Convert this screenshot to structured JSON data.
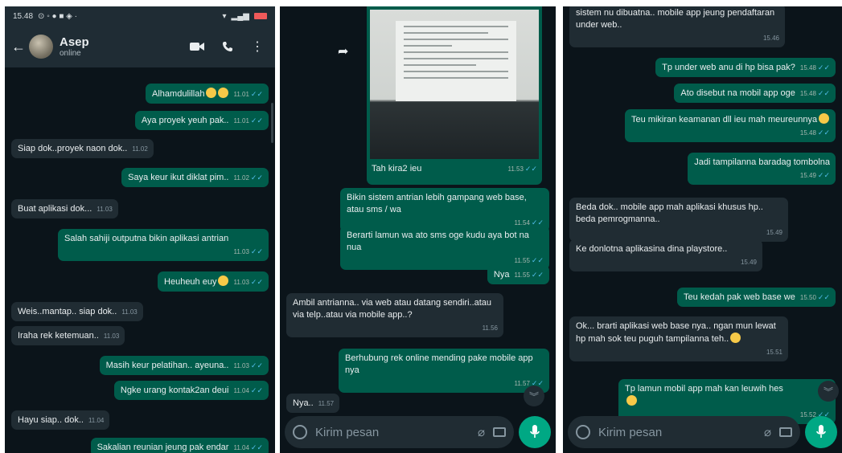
{
  "panel1": {
    "status_time": "15.48",
    "contact_name": "Asep",
    "contact_status": "online",
    "messages": [
      {
        "text": "Alhamdulillah",
        "time": "11.01",
        "dir": "out",
        "emoji": 2
      },
      {
        "text": "Aya proyek yeuh pak..",
        "time": "11.01",
        "dir": "out"
      },
      {
        "text": "Siap dok..proyek naon dok..",
        "time": "11.02",
        "dir": "in"
      },
      {
        "text": "Saya keur ikut diklat pim..",
        "time": "11.02",
        "dir": "out"
      },
      {
        "text": "Buat aplikasi dok...",
        "time": "11.03",
        "dir": "in"
      },
      {
        "text": "Salah sahiji outputna bikin aplikasi antrian",
        "time": "11.03",
        "dir": "out"
      },
      {
        "text": "Heuheuh euy",
        "time": "11.03",
        "dir": "out",
        "emoji": 1
      },
      {
        "text": "Weis..mantap.. siap dok..",
        "time": "11.03",
        "dir": "in"
      },
      {
        "text": "Iraha rek ketemuan..",
        "time": "11.03",
        "dir": "in"
      },
      {
        "text": "Masih keur pelatihan.. ayeuna..",
        "time": "11.03",
        "dir": "out"
      },
      {
        "text": "Ngke urang kontak2an deui",
        "time": "11.04",
        "dir": "out"
      },
      {
        "text": "Hayu siap.. dok..",
        "time": "11.04",
        "dir": "in"
      },
      {
        "text": "Sakalian reunian jeung pak endar",
        "time": "11.04",
        "dir": "out"
      }
    ]
  },
  "panel2": {
    "photo_caption": "Tah kira2 ieu",
    "photo_time": "11.53",
    "messages": [
      {
        "text": "Bikin sistem antrian lebih gampang web base, atau sms / wa",
        "time": "11.54",
        "dir": "out"
      },
      {
        "text": "Berarti lamun wa ato sms oge kudu aya bot na nua",
        "time": "11.55",
        "dir": "out"
      },
      {
        "text": "Nya",
        "time": "11.55",
        "dir": "out"
      },
      {
        "text": "Ambil antrianna.. via web atau datang sendiri..atau via telp..atau via mobile app..?",
        "time": "11.56",
        "dir": "in"
      },
      {
        "text": "Berhubung rek online mending pake mobile app nya",
        "time": "11.57",
        "dir": "out"
      },
      {
        "text": "Nya..",
        "time": "11.57",
        "dir": "in"
      }
    ],
    "input_placeholder": "Kirim pesan"
  },
  "panel3": {
    "messages": [
      {
        "text": "sistem nu dibuatna.. mobile app jeung pendaftaran under web..",
        "time": "15.46",
        "dir": "in"
      },
      {
        "text": "Tp under web anu di hp bisa pak?",
        "time": "15.48",
        "dir": "out"
      },
      {
        "text": "Ato disebut na mobil app oge",
        "time": "15.48",
        "dir": "out"
      },
      {
        "text": "Teu mikiran keamanan dll ieu mah meureunnya",
        "time": "15.48",
        "dir": "out",
        "emoji": 1
      },
      {
        "text": "Jadi tampilanna baradag tombolna",
        "time": "15.49",
        "dir": "out"
      },
      {
        "text": "Beda dok.. mobile app mah aplikasi khusus hp.. beda pemrogmanna..",
        "time": "15.49",
        "dir": "in"
      },
      {
        "text": "Ke donlotna aplikasina dina playstore..",
        "time": "15.49",
        "dir": "in"
      },
      {
        "text": "Teu kedah pak web base we",
        "time": "15.50",
        "dir": "out"
      },
      {
        "text": "Ok... brarti aplikasi web base nya.. ngan mun lewat hp mah sok teu puguh tampilanna teh..",
        "time": "15.51",
        "dir": "in",
        "emoji": 1
      },
      {
        "text": "Tp lamun mobil app mah kan leuwih hes",
        "time": "15.52",
        "dir": "out",
        "emoji": 1
      }
    ],
    "input_placeholder": "Kirim pesan"
  },
  "colors": {
    "bg": "#0b141a",
    "outgoing": "#005c4b",
    "incoming": "#202c33",
    "accent": "#00a884"
  }
}
